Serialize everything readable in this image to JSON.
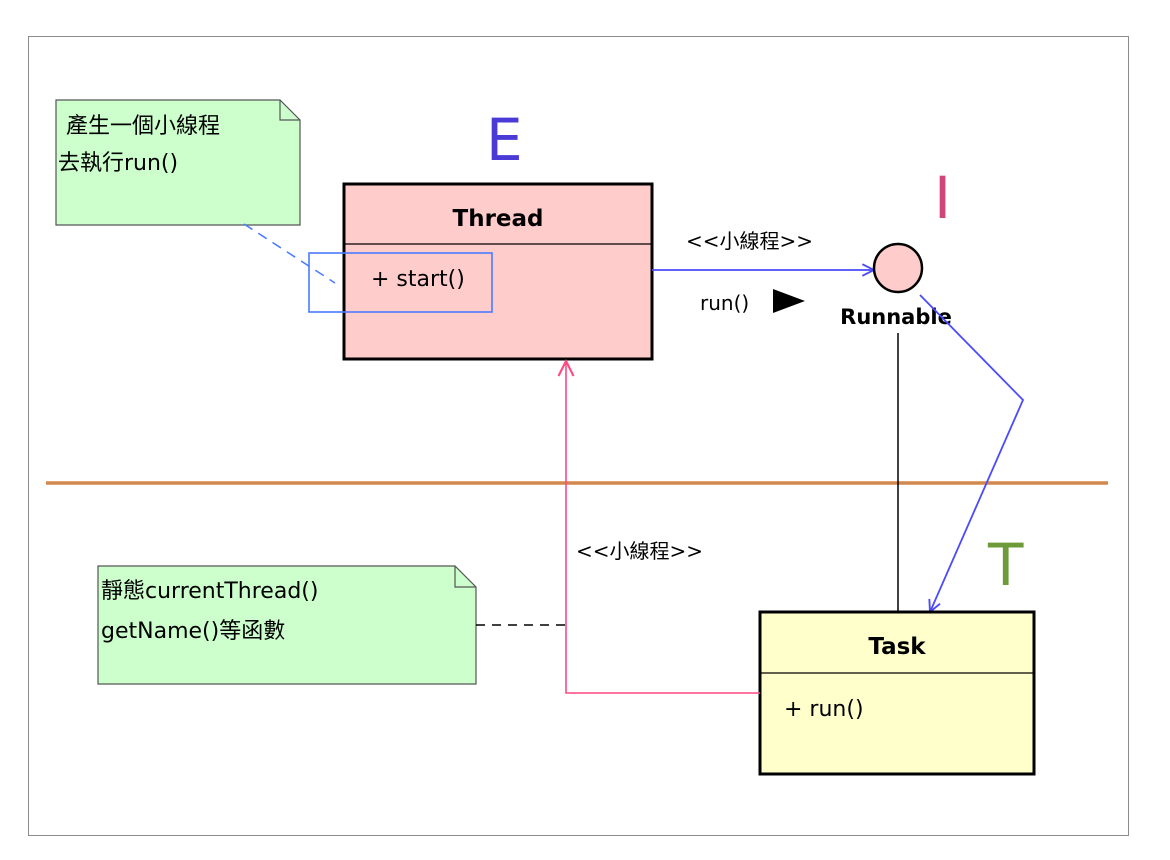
{
  "letters": {
    "e": "E",
    "i": "I",
    "t": "T"
  },
  "notes": {
    "top": {
      "line1": "產生一個小線程",
      "line2": "去執行run()"
    },
    "bottom": {
      "line1": "靜態currentThread()",
      "line2": "getName()等函數"
    }
  },
  "classes": {
    "thread": {
      "name": "Thread",
      "members": [
        "+ start()"
      ]
    },
    "task": {
      "name": "Task",
      "members": [
        "+ run()"
      ]
    }
  },
  "interface": {
    "name": "Runnable"
  },
  "edges": {
    "thread_to_runnable_label": "<<小線程>>",
    "run_label": "run()",
    "task_to_thread_label": "<<小線程>>"
  },
  "colors": {
    "note_fill": "#ccffcc",
    "thread_fill": "#ffcccc",
    "task_fill": "#ffffcc",
    "interface_fill": "#ffcccc",
    "separator": "#d2874c",
    "blue_edge": "#4a4aff",
    "pink_edge": "#ff4a80",
    "letter_e": "#4a3bd6",
    "letter_i": "#d0457a",
    "letter_t": "#6f9a3a"
  }
}
